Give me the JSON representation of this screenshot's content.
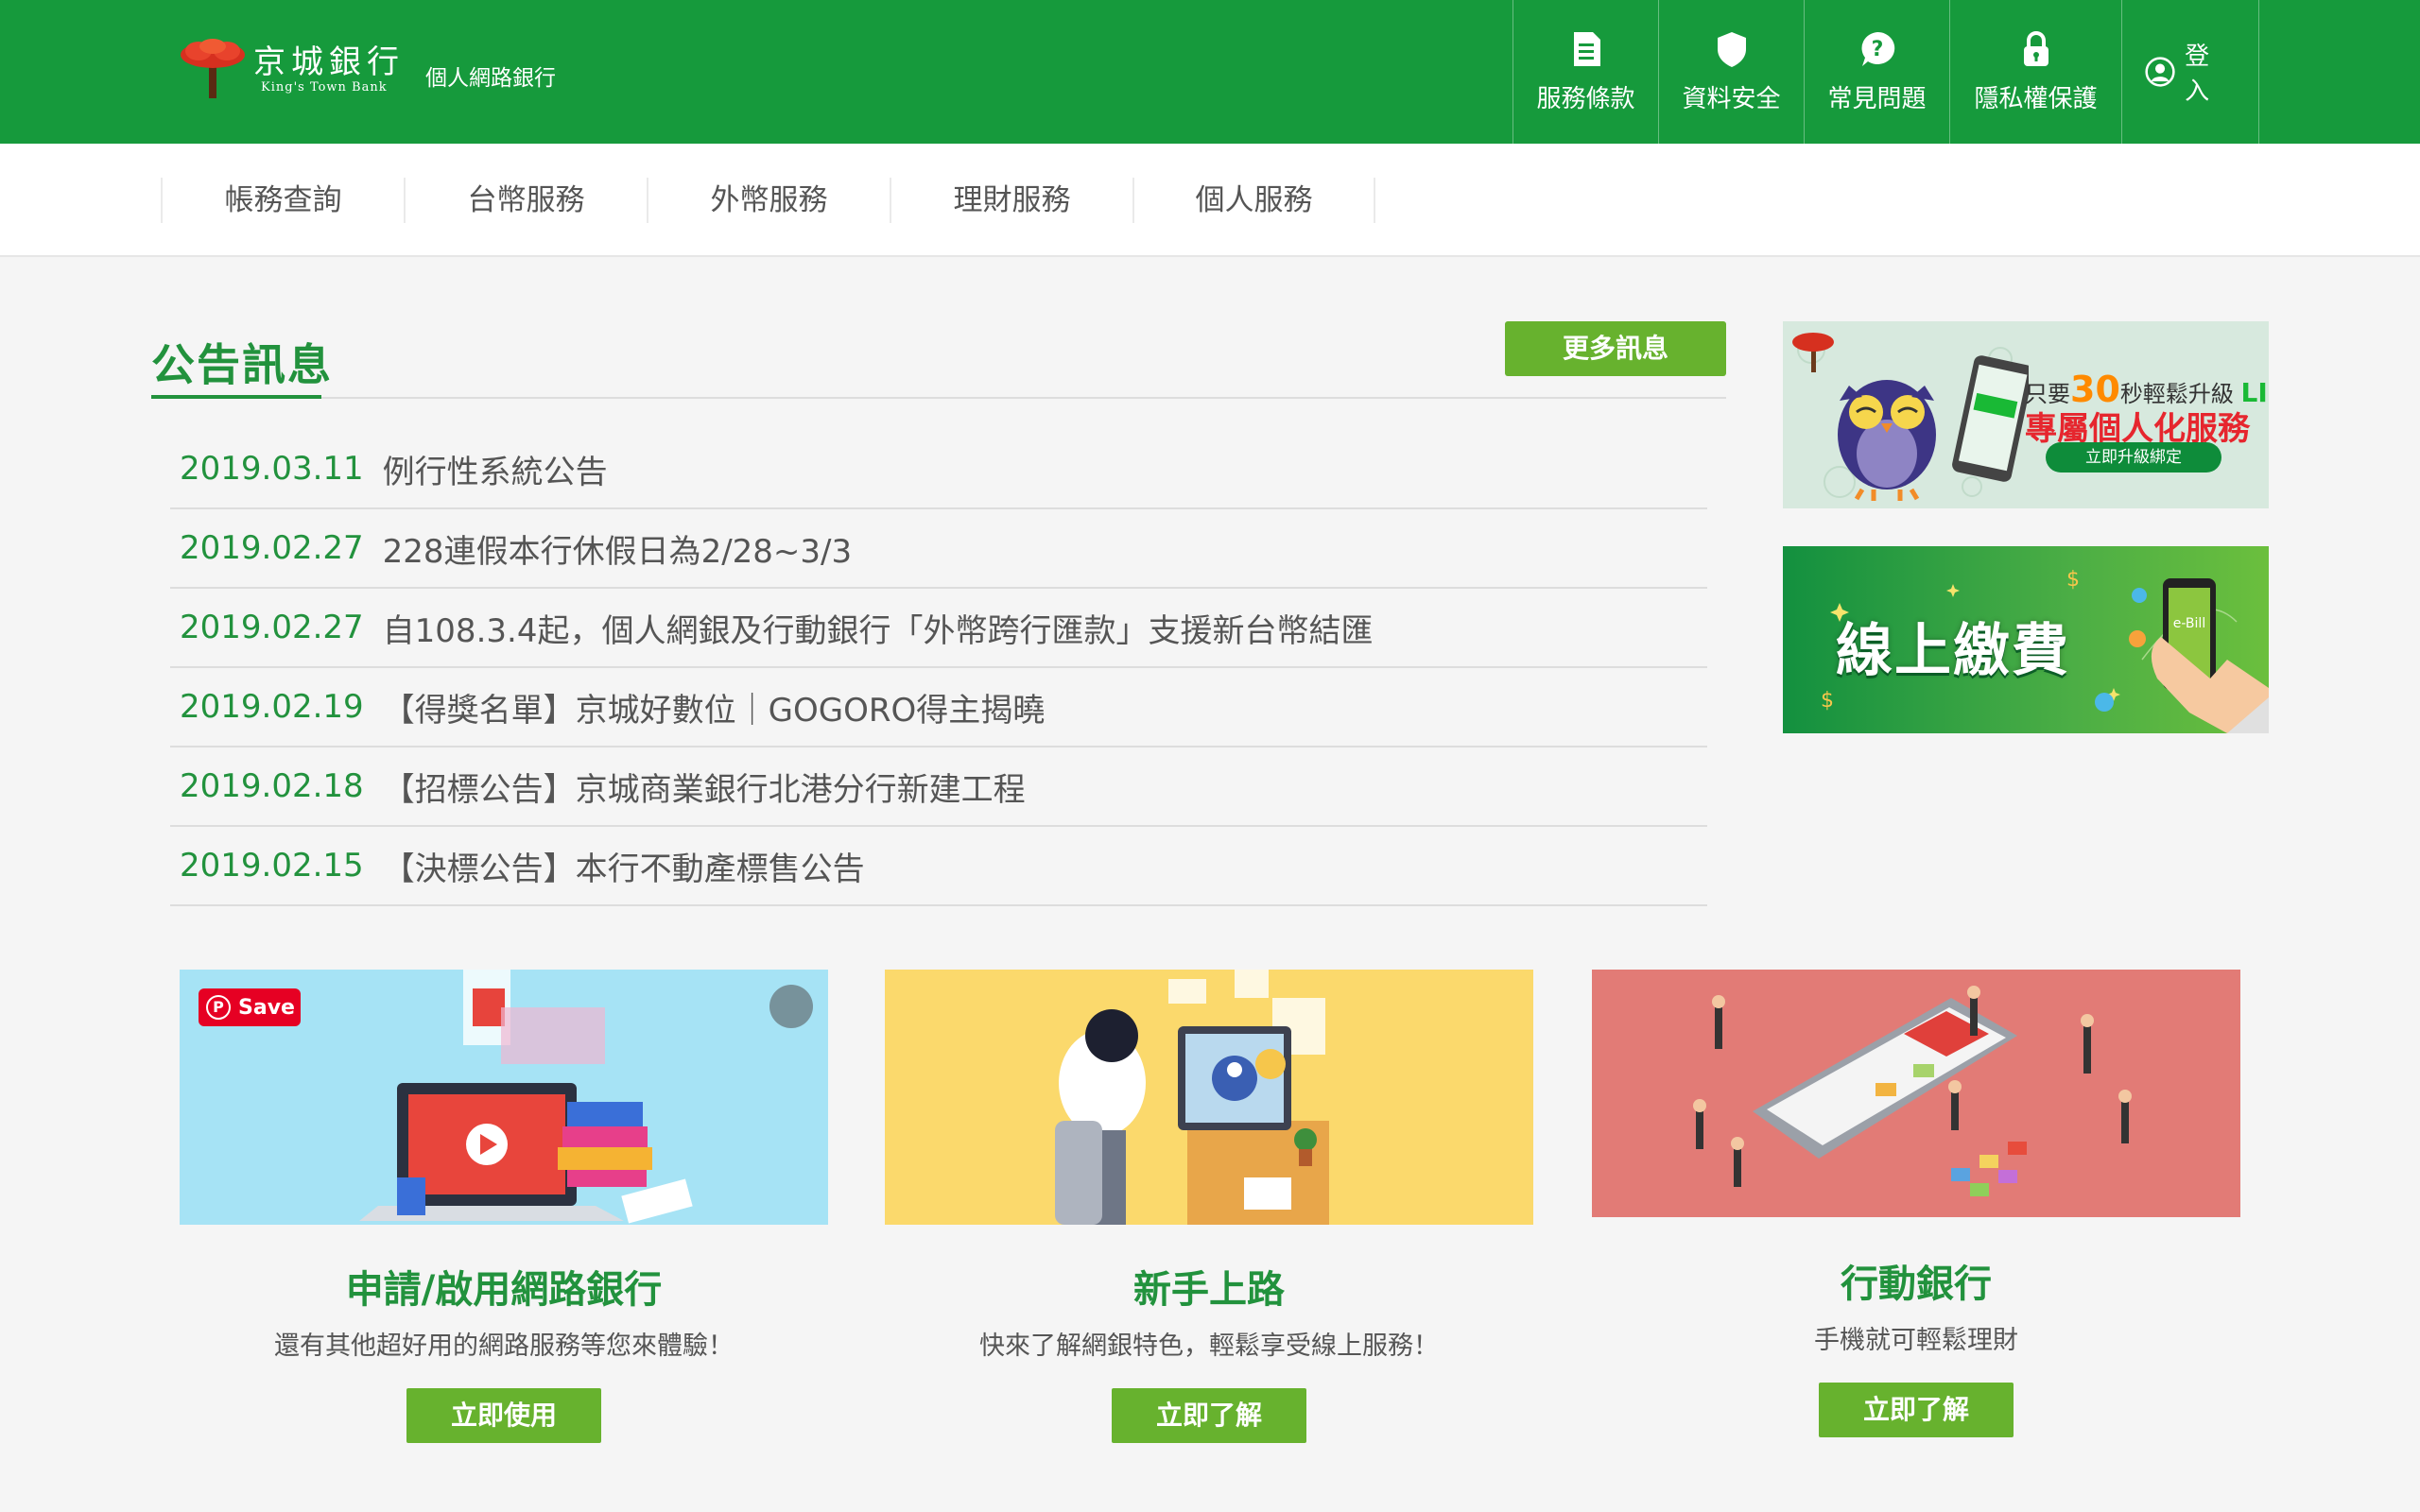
{
  "brand": {
    "name_cn": "京城銀行",
    "name_en": "King's Town Bank",
    "subtitle": "個人網路銀行",
    "primary_color": "#169a3c",
    "accent_color": "#67b22e"
  },
  "topnav": {
    "terms": {
      "label": "服務條款",
      "icon": "document-icon"
    },
    "security": {
      "label": "資料安全",
      "icon": "shield-icon"
    },
    "faq": {
      "label": "常見問題",
      "icon": "question-icon"
    },
    "privacy": {
      "label": "隱私權保護",
      "icon": "lock-icon"
    },
    "login": {
      "label": "登入",
      "icon": "user-icon"
    }
  },
  "subnav": {
    "items": [
      "帳務查詢",
      "台幣服務",
      "外幣服務",
      "理財服務",
      "個人服務"
    ]
  },
  "announcements": {
    "title": "公告訊息",
    "more_label": "更多訊息",
    "items": [
      {
        "date": "2019.03.11",
        "text": "例行性系統公告"
      },
      {
        "date": "2019.02.27",
        "text": "228連假本行休假日為2/28~3/3"
      },
      {
        "date": "2019.02.27",
        "text": "自108.3.4起，個人網銀及行動銀行「外幣跨行匯款」支援新台幣結匯"
      },
      {
        "date": "2019.02.19",
        "text": "【得獎名單】京城好數位｜GOGORO得主揭曉"
      },
      {
        "date": "2019.02.18",
        "text": "【招標公告】京城商業銀行北港分行新建工程"
      },
      {
        "date": "2019.02.15",
        "text": "【決標公告】本行不動產標售公告"
      }
    ]
  },
  "banners": {
    "line": {
      "text_prefix": "只要",
      "text_num": "30",
      "text_mid": "秒輕鬆升級",
      "text_line": "LINE",
      "headline": "專屬個人化服務",
      "cta": "立即升級綁定"
    },
    "bill": {
      "headline": "線上繳費",
      "phone_label": "e-Bill"
    }
  },
  "cards": [
    {
      "title": "申請/啟用網路銀行",
      "desc": "還有其他超好用的網路服務等您來體驗！",
      "button": "立即使用",
      "save_label": "Save"
    },
    {
      "title": "新手上路",
      "desc": "快來了解網銀特色，輕鬆享受線上服務！",
      "button": "立即了解"
    },
    {
      "title": "行動銀行",
      "desc": "手機就可輕鬆理財",
      "button": "立即了解"
    }
  ]
}
